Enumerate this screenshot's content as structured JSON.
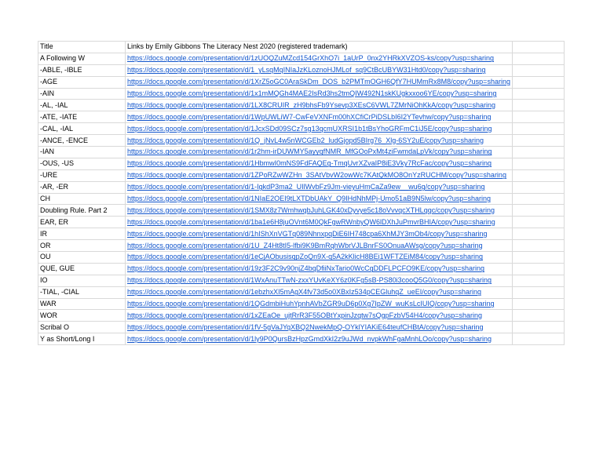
{
  "header": {
    "title": "Title",
    "links": "Links by Emily Gibbons The Literacy Nest 2020 (registered trademark)"
  },
  "colors": {
    "link": "#1155cc",
    "grid": "#d9d9d9"
  },
  "rows": [
    {
      "title": "A Following W",
      "url": "https://docs.google.com/presentation/d/1zUOQZuMZcd154GrXhO7i_1aUrP_0nx2YHRkXVZOS-ks/copy?usp=sharing"
    },
    {
      "title": "-ABLE, -IBLE",
      "url": "https://docs.google.com/presentation/d/1_yLsqMqINIaJzKLoznoHJMLof_sq9CtBcUBYW31Htd0/copy?usp=sharing"
    },
    {
      "title": "-AGE",
      "url": "https://docs.google.com/presentation/d/1XrZ5oGC0AraSkDm_DOS_b2PMTmOGH6QfY7HUMmRx8M8/copy?usp=sharing"
    },
    {
      "title": "-AIN",
      "url": "https://docs.google.com/presentation/d/1x1mMQGh4MAE2IsRd3hs2tmQIW492N1skKUgkxxoo6YE/copy?usp=sharing"
    },
    {
      "title": "-AL, -IAL",
      "url": "https://docs.google.com/presentation/d/1LX8CRUIR_zH9bhsFb9Ysevp3XEsC6VWL7ZMrNiOhKkA/copy?usp=sharing"
    },
    {
      "title": "-ATE, -IATE",
      "url": "https://docs.google.com/presentation/d/1WpUWLiW7-CwFeVXNFm00hXCfiCrPiDSLbI6I2YTevhw/copy?usp=sharing"
    },
    {
      "title": "-CAL, -IAL",
      "url": "https://docs.google.com/presentation/d/1JcxSDd09SCz7sg13qcmUXRSI1b1tBsYhoGRFmC1iJ5E/copy?usp=sharing"
    },
    {
      "title": "-ANCE, -ENCE",
      "url": "https://docs.google.com/presentation/d/1Q_jNvL4w5nWCGEb2_ludGjopd5BIrg76_Xlg-6SY2uE/copy?usp=sharing"
    },
    {
      "title": "-IAN",
      "url": "https://docs.google.com/presentation/d/1r2hm-irDUWMY5ayyqfNMR_MfGOoPxMt4ziFwmdaLpVk/copy?usp=sharing"
    },
    {
      "title": "-OUS, -US",
      "url": "https://docs.google.com/presentation/d/1HbmwI0mNS9FdFAQEg-TmqUvrXZvaIP8iE3Vky7RcFac/copy?usp=sharing"
    },
    {
      "title": "-URE",
      "url": "https://docs.google.com/presentation/d/1ZPoRZwWZHn_3SAtVbvW2owWc7KAtQkMO8OnYzRUCHM/copy?usp=sharing"
    },
    {
      "title": "-AR, -ER",
      "url": "https://docs.google.com/presentation/d/1-IgkdP3ma2_UIlWvbFz9Jm-vieyuHmCaZa9ew__wu6g/copy?usp=sharing"
    },
    {
      "title": "CH",
      "url": "https://docs.google.com/presentation/d/1NIaE2OEI9tLXTDbUAkY_Q9IHdNhMPj-Umo51aB9N5lw/copy?usp=sharing"
    },
    {
      "title": "Doubling Rule. Part 2",
      "url": "https://docs.google.com/presentation/d/1SMX8z7WmhwqbJuhLGK40xDyvye5c18oVvvqcXTHLqqc/copy?usp=sharing"
    },
    {
      "title": "EAR, ER",
      "url": "https://docs.google.com/presentation/d/1ba1e6H8juOVnt6M0QkFgwRWnbyQW6lDXhJuPmvrBHIA/copy?usp=sharing"
    },
    {
      "title": "IR",
      "url": "https://docs.google.com/presentation/d/1hIShXnVGTq089NhnxpqDiE6IH748cpa6XhMJY3mOb4/copy?usp=sharing"
    },
    {
      "title": "OR",
      "url": "https://docs.google.com/presentation/d/1U_Z4Ht8tI5-lfbi9K9BmRqhWbrVJLBnrFS0OnuaAWsg/copy?usp=sharing"
    },
    {
      "title": "OU",
      "url": "https://docs.google.com/presentation/d/1eCjAObusisqpZoQn9X-q5A2kKlicH8BEi1WFTZEiM84/copy?usp=sharing"
    },
    {
      "title": "QUE, GUE",
      "url": "https://docs.google.com/presentation/d/19z3F2C9v90njZ4bqDfiiNxTario0WcCgDDFLPCFO9KE/copy?usp=sharing"
    },
    {
      "title": "IO",
      "url": "https://docs.google.com/presentation/d/1WxAnuTTwN-zxxYUvKeXY6z0KFg5sB-PS80i3cooQ5G0/copy?usp=sharing"
    },
    {
      "title": "-TIAL, -CIAL",
      "url": "https://docs.google.com/presentation/d/1ebzhxXI5mAgX4fv73d5o0XBxIz534pCEGluhqZ_ueEI/copy?usp=sharing"
    },
    {
      "title": "WAR",
      "url": "https://docs.google.com/presentation/d/1QGdmbiHuhYpnhAVbZGR9uD6p0Xg7IpZW_wuKsLcIUIQ/copy?usp=sharing"
    },
    {
      "title": "WOR",
      "url": "https://docs.google.com/presentation/d/1xZEaOe_ujtRrR3F55OBtYxpinJzqtw7sQgpFzbV54H4/copy?usp=sharing"
    },
    {
      "title": "Scribal O",
      "url": "https://docs.google.com/presentation/d/1fV-5gVaJYqXBQ2NwekMpQ-OYklYIAKiE64teufCHBtA/copy?usp=sharing"
    },
    {
      "title": "Y as Short/Long I",
      "url": "https://docs.google.com/presentation/d/1ly9P0QursBzHpzGmdXkI2z9uJWd_nvpkWhFgaMnhLOo/copy?usp=sharing"
    }
  ]
}
